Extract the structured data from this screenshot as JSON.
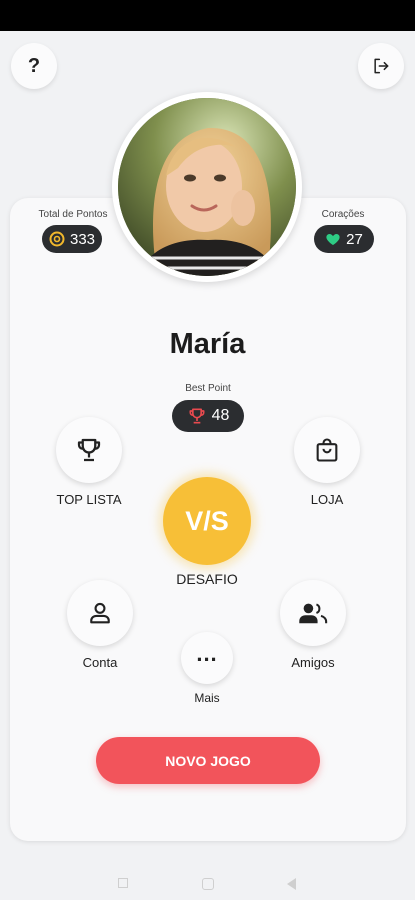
{
  "header": {
    "help_label": "?",
    "help_icon": "question-mark-icon",
    "logout_icon": "logout-icon"
  },
  "profile": {
    "avatar_icon": "user-photo",
    "name": "María",
    "total_points_label": "Total de Pontos",
    "total_points": "333",
    "hearts_label": "Corações",
    "hearts": "27",
    "best_point_label": "Best Point",
    "best_point": "48"
  },
  "menu": {
    "top_list": "TOP LISTA",
    "shop": "LOJA",
    "challenge_label": "V/S",
    "challenge": "DESAFIO",
    "account": "Conta",
    "friends": "Amigos",
    "more_label": "...",
    "more": "Mais"
  },
  "actions": {
    "new_game": "NOVO JOGO"
  },
  "colors": {
    "accent_yellow": "#f7bf37",
    "accent_red": "#f2545b",
    "pill_dark": "#2b2d30",
    "heart_green": "#2ecc85",
    "trophy_red": "#e84a4f",
    "coin_yellow": "#f2b82c"
  }
}
